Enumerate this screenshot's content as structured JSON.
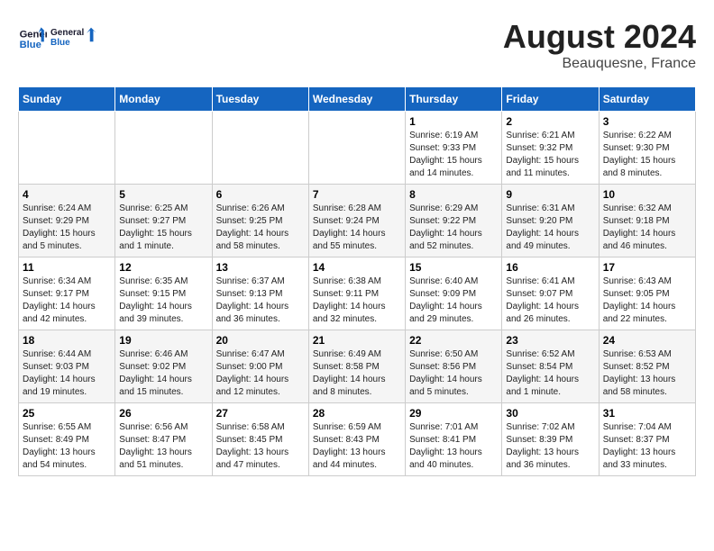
{
  "header": {
    "logo_line1": "General",
    "logo_line2": "Blue",
    "month": "August 2024",
    "location": "Beauquesne, France"
  },
  "days_of_week": [
    "Sunday",
    "Monday",
    "Tuesday",
    "Wednesday",
    "Thursday",
    "Friday",
    "Saturday"
  ],
  "weeks": [
    [
      {
        "day": "",
        "info": ""
      },
      {
        "day": "",
        "info": ""
      },
      {
        "day": "",
        "info": ""
      },
      {
        "day": "",
        "info": ""
      },
      {
        "day": "1",
        "info": "Sunrise: 6:19 AM\nSunset: 9:33 PM\nDaylight: 15 hours\nand 14 minutes."
      },
      {
        "day": "2",
        "info": "Sunrise: 6:21 AM\nSunset: 9:32 PM\nDaylight: 15 hours\nand 11 minutes."
      },
      {
        "day": "3",
        "info": "Sunrise: 6:22 AM\nSunset: 9:30 PM\nDaylight: 15 hours\nand 8 minutes."
      }
    ],
    [
      {
        "day": "4",
        "info": "Sunrise: 6:24 AM\nSunset: 9:29 PM\nDaylight: 15 hours\nand 5 minutes."
      },
      {
        "day": "5",
        "info": "Sunrise: 6:25 AM\nSunset: 9:27 PM\nDaylight: 15 hours\nand 1 minute."
      },
      {
        "day": "6",
        "info": "Sunrise: 6:26 AM\nSunset: 9:25 PM\nDaylight: 14 hours\nand 58 minutes."
      },
      {
        "day": "7",
        "info": "Sunrise: 6:28 AM\nSunset: 9:24 PM\nDaylight: 14 hours\nand 55 minutes."
      },
      {
        "day": "8",
        "info": "Sunrise: 6:29 AM\nSunset: 9:22 PM\nDaylight: 14 hours\nand 52 minutes."
      },
      {
        "day": "9",
        "info": "Sunrise: 6:31 AM\nSunset: 9:20 PM\nDaylight: 14 hours\nand 49 minutes."
      },
      {
        "day": "10",
        "info": "Sunrise: 6:32 AM\nSunset: 9:18 PM\nDaylight: 14 hours\nand 46 minutes."
      }
    ],
    [
      {
        "day": "11",
        "info": "Sunrise: 6:34 AM\nSunset: 9:17 PM\nDaylight: 14 hours\nand 42 minutes."
      },
      {
        "day": "12",
        "info": "Sunrise: 6:35 AM\nSunset: 9:15 PM\nDaylight: 14 hours\nand 39 minutes."
      },
      {
        "day": "13",
        "info": "Sunrise: 6:37 AM\nSunset: 9:13 PM\nDaylight: 14 hours\nand 36 minutes."
      },
      {
        "day": "14",
        "info": "Sunrise: 6:38 AM\nSunset: 9:11 PM\nDaylight: 14 hours\nand 32 minutes."
      },
      {
        "day": "15",
        "info": "Sunrise: 6:40 AM\nSunset: 9:09 PM\nDaylight: 14 hours\nand 29 minutes."
      },
      {
        "day": "16",
        "info": "Sunrise: 6:41 AM\nSunset: 9:07 PM\nDaylight: 14 hours\nand 26 minutes."
      },
      {
        "day": "17",
        "info": "Sunrise: 6:43 AM\nSunset: 9:05 PM\nDaylight: 14 hours\nand 22 minutes."
      }
    ],
    [
      {
        "day": "18",
        "info": "Sunrise: 6:44 AM\nSunset: 9:03 PM\nDaylight: 14 hours\nand 19 minutes."
      },
      {
        "day": "19",
        "info": "Sunrise: 6:46 AM\nSunset: 9:02 PM\nDaylight: 14 hours\nand 15 minutes."
      },
      {
        "day": "20",
        "info": "Sunrise: 6:47 AM\nSunset: 9:00 PM\nDaylight: 14 hours\nand 12 minutes."
      },
      {
        "day": "21",
        "info": "Sunrise: 6:49 AM\nSunset: 8:58 PM\nDaylight: 14 hours\nand 8 minutes."
      },
      {
        "day": "22",
        "info": "Sunrise: 6:50 AM\nSunset: 8:56 PM\nDaylight: 14 hours\nand 5 minutes."
      },
      {
        "day": "23",
        "info": "Sunrise: 6:52 AM\nSunset: 8:54 PM\nDaylight: 14 hours\nand 1 minute."
      },
      {
        "day": "24",
        "info": "Sunrise: 6:53 AM\nSunset: 8:52 PM\nDaylight: 13 hours\nand 58 minutes."
      }
    ],
    [
      {
        "day": "25",
        "info": "Sunrise: 6:55 AM\nSunset: 8:49 PM\nDaylight: 13 hours\nand 54 minutes."
      },
      {
        "day": "26",
        "info": "Sunrise: 6:56 AM\nSunset: 8:47 PM\nDaylight: 13 hours\nand 51 minutes."
      },
      {
        "day": "27",
        "info": "Sunrise: 6:58 AM\nSunset: 8:45 PM\nDaylight: 13 hours\nand 47 minutes."
      },
      {
        "day": "28",
        "info": "Sunrise: 6:59 AM\nSunset: 8:43 PM\nDaylight: 13 hours\nand 44 minutes."
      },
      {
        "day": "29",
        "info": "Sunrise: 7:01 AM\nSunset: 8:41 PM\nDaylight: 13 hours\nand 40 minutes."
      },
      {
        "day": "30",
        "info": "Sunrise: 7:02 AM\nSunset: 8:39 PM\nDaylight: 13 hours\nand 36 minutes."
      },
      {
        "day": "31",
        "info": "Sunrise: 7:04 AM\nSunset: 8:37 PM\nDaylight: 13 hours\nand 33 minutes."
      }
    ]
  ]
}
